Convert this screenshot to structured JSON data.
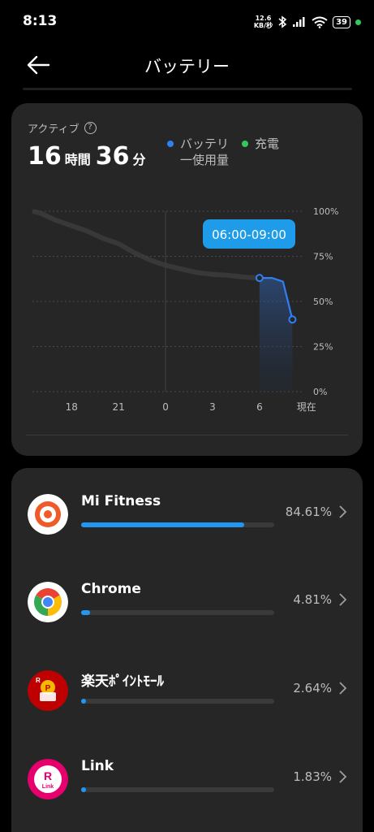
{
  "status": {
    "time": "8:13",
    "net_speed_value": "12.6",
    "net_speed_unit": "KB/秒",
    "battery": "39"
  },
  "header": {
    "title": "バッテリー"
  },
  "usage": {
    "active_label": "アクティブ",
    "hours": "16",
    "hours_unit": "時間",
    "minutes": "36",
    "minutes_unit": "分",
    "legend": [
      {
        "label": "バッテリ\n一使用量",
        "color": "#2f7ff5"
      },
      {
        "label": "充電",
        "color": "#34c759"
      }
    ]
  },
  "chart_data": {
    "type": "line",
    "x_tick_labels": [
      "18",
      "21",
      "0",
      "3",
      "6",
      "現在"
    ],
    "y_tick_labels": [
      "100%",
      "75%",
      "50%",
      "25%",
      "0%"
    ],
    "ylim": [
      0,
      100
    ],
    "grid": true,
    "tooltip": "06:00-09:00",
    "series": [
      {
        "x": [
          15.5,
          16,
          17,
          18,
          19,
          20,
          21,
          22,
          23,
          24,
          25,
          26,
          27,
          28,
          29,
          30,
          30.8,
          31.5,
          32.1
        ],
        "y": [
          100,
          99,
          95,
          92,
          89,
          85,
          82,
          77,
          73,
          70,
          68,
          66,
          65,
          64.5,
          63.5,
          63,
          63,
          61,
          40
        ]
      }
    ],
    "highlight_range": [
      30,
      33
    ],
    "highlight_points": [
      {
        "x": 30,
        "y": 63
      },
      {
        "x": 32.1,
        "y": 40
      }
    ]
  },
  "apps": [
    {
      "name": "Mi Fitness",
      "percent": "84.61%",
      "usage_fraction": 0.8461,
      "icon": "mi-fitness-icon"
    },
    {
      "name": "Chrome",
      "percent": "4.81%",
      "usage_fraction": 0.0481,
      "icon": "chrome-icon"
    },
    {
      "name": "楽天ﾎﾟｲﾝﾄﾓｰﾙ",
      "percent": "2.64%",
      "usage_fraction": 0.0264,
      "icon": "rakuten-point-mall-icon"
    },
    {
      "name": "Link",
      "percent": "1.83%",
      "usage_fraction": 0.0183,
      "icon": "rakuten-link-icon"
    }
  ]
}
